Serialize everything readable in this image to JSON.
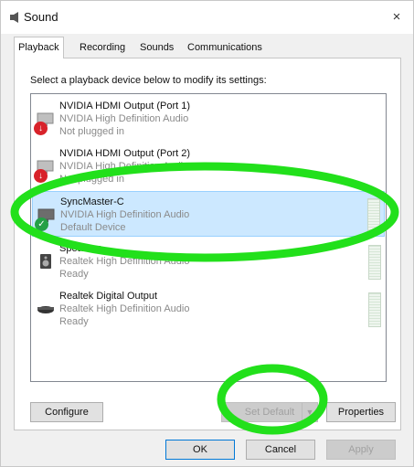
{
  "window": {
    "title": "Sound",
    "close_label": "×"
  },
  "tabs": [
    {
      "label": "Playback",
      "active": true
    },
    {
      "label": "Recording",
      "active": false
    },
    {
      "label": "Sounds",
      "active": false
    },
    {
      "label": "Communications",
      "active": false
    }
  ],
  "instruction": "Select a playback device below to modify its settings:",
  "devices": [
    {
      "name": "NVIDIA HDMI Output (Port 1)",
      "driver": "NVIDIA High Definition Audio",
      "status": "Not plugged in",
      "icon": "monitor-speaker-icon",
      "badge": "unplugged-icon"
    },
    {
      "name": "NVIDIA HDMI Output (Port 2)",
      "driver": "NVIDIA High Definition Audio",
      "status": "Not plugged in",
      "icon": "monitor-speaker-icon",
      "badge": "unplugged-icon"
    },
    {
      "name": "SyncMaster-C",
      "driver": "NVIDIA High Definition Audio",
      "status": "Default Device",
      "icon": "monitor-speaker-icon",
      "badge": "default-check-icon",
      "selected": true
    },
    {
      "name": "Speakers",
      "driver": "Realtek High Definition Audio",
      "status": "Ready",
      "icon": "speaker-icon"
    },
    {
      "name": "Realtek Digital Output",
      "driver": "Realtek High Definition Audio",
      "status": "Ready",
      "icon": "digital-output-icon"
    }
  ],
  "buttons": {
    "configure": "Configure",
    "set_default": "Set Default",
    "properties": "Properties",
    "ok": "OK",
    "cancel": "Cancel",
    "apply": "Apply"
  },
  "colors": {
    "annotation": "#22e01b",
    "selection": "#cce8ff",
    "default_badge": "#24a046",
    "unplugged_badge": "#d8222a"
  }
}
